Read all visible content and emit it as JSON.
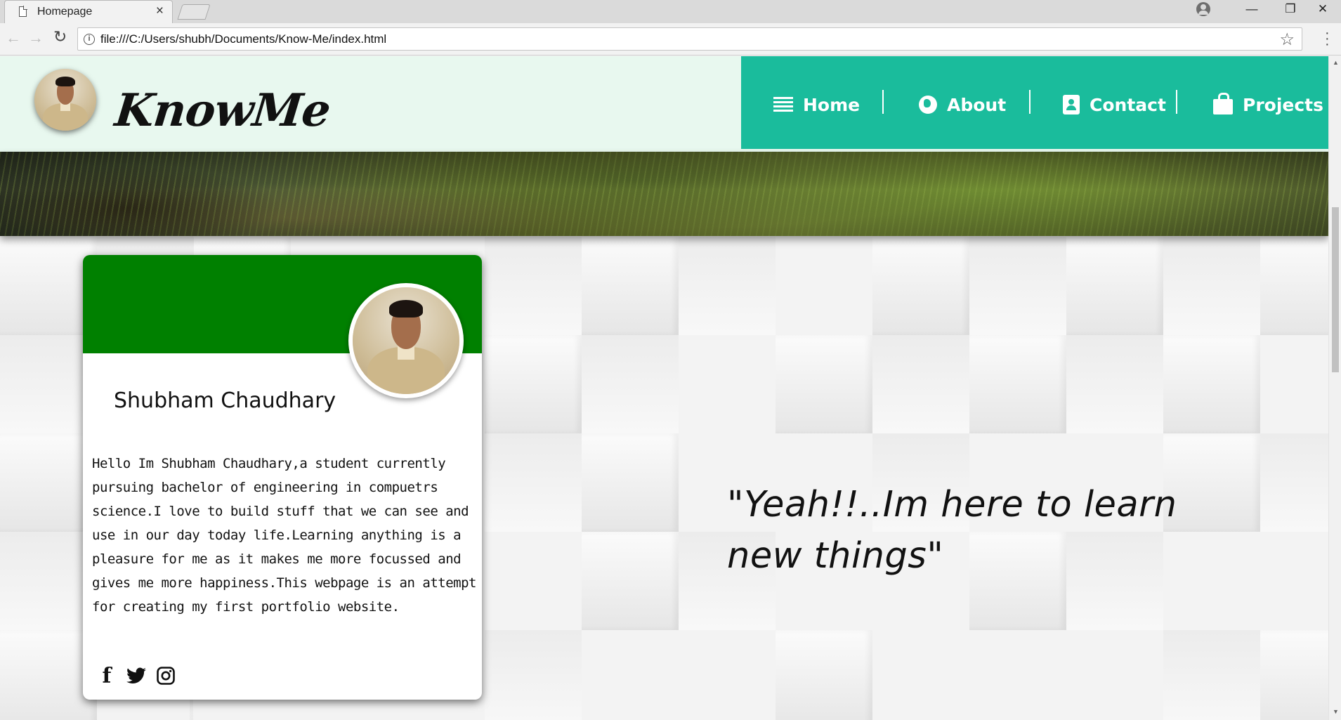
{
  "browser": {
    "tab_title": "Homepage",
    "tab_close": "×",
    "url": "file:///C:/Users/shubh/Documents/Know-Me/index.html",
    "window_controls": [
      "—",
      "❐",
      "✕"
    ]
  },
  "site": {
    "brand": "KnowMe",
    "nav": [
      {
        "label": "Home",
        "icon": "menu-bars-icon"
      },
      {
        "label": "About",
        "icon": "globe-icon"
      },
      {
        "label": "Contact",
        "icon": "contact-card-icon"
      },
      {
        "label": "Projects",
        "icon": "shopping-bag-icon"
      }
    ],
    "accent_color": "#1abc9c",
    "card_header_color": "#008000"
  },
  "profile": {
    "name": "Shubham Chaudhary",
    "bio": "Hello Im Shubham Chaudhary,a student currently pursuing bachelor of engineering in compuetrs science.I love to build stuff that we can see and use in our day today life.Learning anything is a pleasure for me as it makes me more focussed and gives me more happiness.This webpage is an attempt for creating my first portfolio website.",
    "socials": [
      {
        "name": "facebook-icon",
        "glyph": "f"
      },
      {
        "name": "twitter-icon",
        "glyph": "🐦"
      },
      {
        "name": "instagram-icon",
        "glyph": "◎"
      }
    ]
  },
  "quote": "\"Yeah!!..Im here to learn new things\""
}
